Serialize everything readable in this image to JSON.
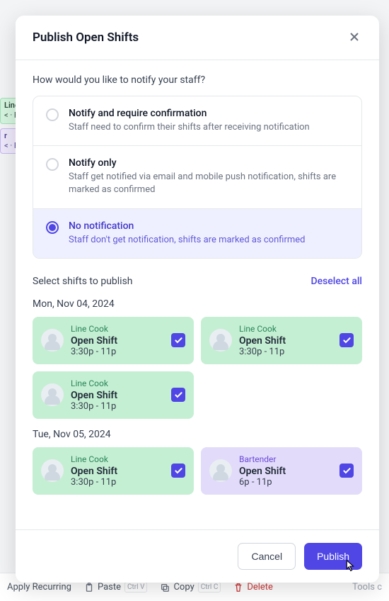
{
  "bg": {
    "ev1_role": "Line",
    "ev1_sub": "< · F",
    "ev2_role": "r",
    "ev2_sub": "< · F",
    "toolbar": {
      "apply": "Apply Recurring",
      "paste": "Paste",
      "paste_kbd": "Ctrl V",
      "copy": "Copy",
      "copy_kbd": "Ctrl C",
      "delete": "Delete",
      "tools": "Tools c"
    }
  },
  "modal": {
    "title": "Publish Open Shifts",
    "notify_question": "How would you like to notify your staff?",
    "options": {
      "o1": {
        "title": "Notify and require confirmation",
        "desc": "Staff need to confirm their shifts after receiving notification"
      },
      "o2": {
        "title": "Notify only",
        "desc": "Staff get notified via email and mobile push notification, shifts are marked as confirmed"
      },
      "o3": {
        "title": "No notification",
        "desc": "Staff don't get notification, shifts are marked as confirmed"
      }
    },
    "select_label": "Select shifts to publish",
    "deselect": "Deselect all",
    "days": {
      "d1": {
        "label": "Mon, Nov 04, 2024",
        "shifts": [
          {
            "role": "Line Cook",
            "title": "Open Shift",
            "time": "3:30p - 11p"
          },
          {
            "role": "Line Cook",
            "title": "Open Shift",
            "time": "3:30p - 11p"
          },
          {
            "role": "Line Cook",
            "title": "Open Shift",
            "time": "3:30p - 11p"
          }
        ]
      },
      "d2": {
        "label": "Tue, Nov 05, 2024",
        "shifts": [
          {
            "role": "Line Cook",
            "title": "Open Shift",
            "time": "3:30p - 11p"
          },
          {
            "role": "Bartender",
            "title": "Open Shift",
            "time": "6p - 11p"
          }
        ]
      }
    },
    "cancel": "Cancel",
    "publish": "Publish"
  }
}
